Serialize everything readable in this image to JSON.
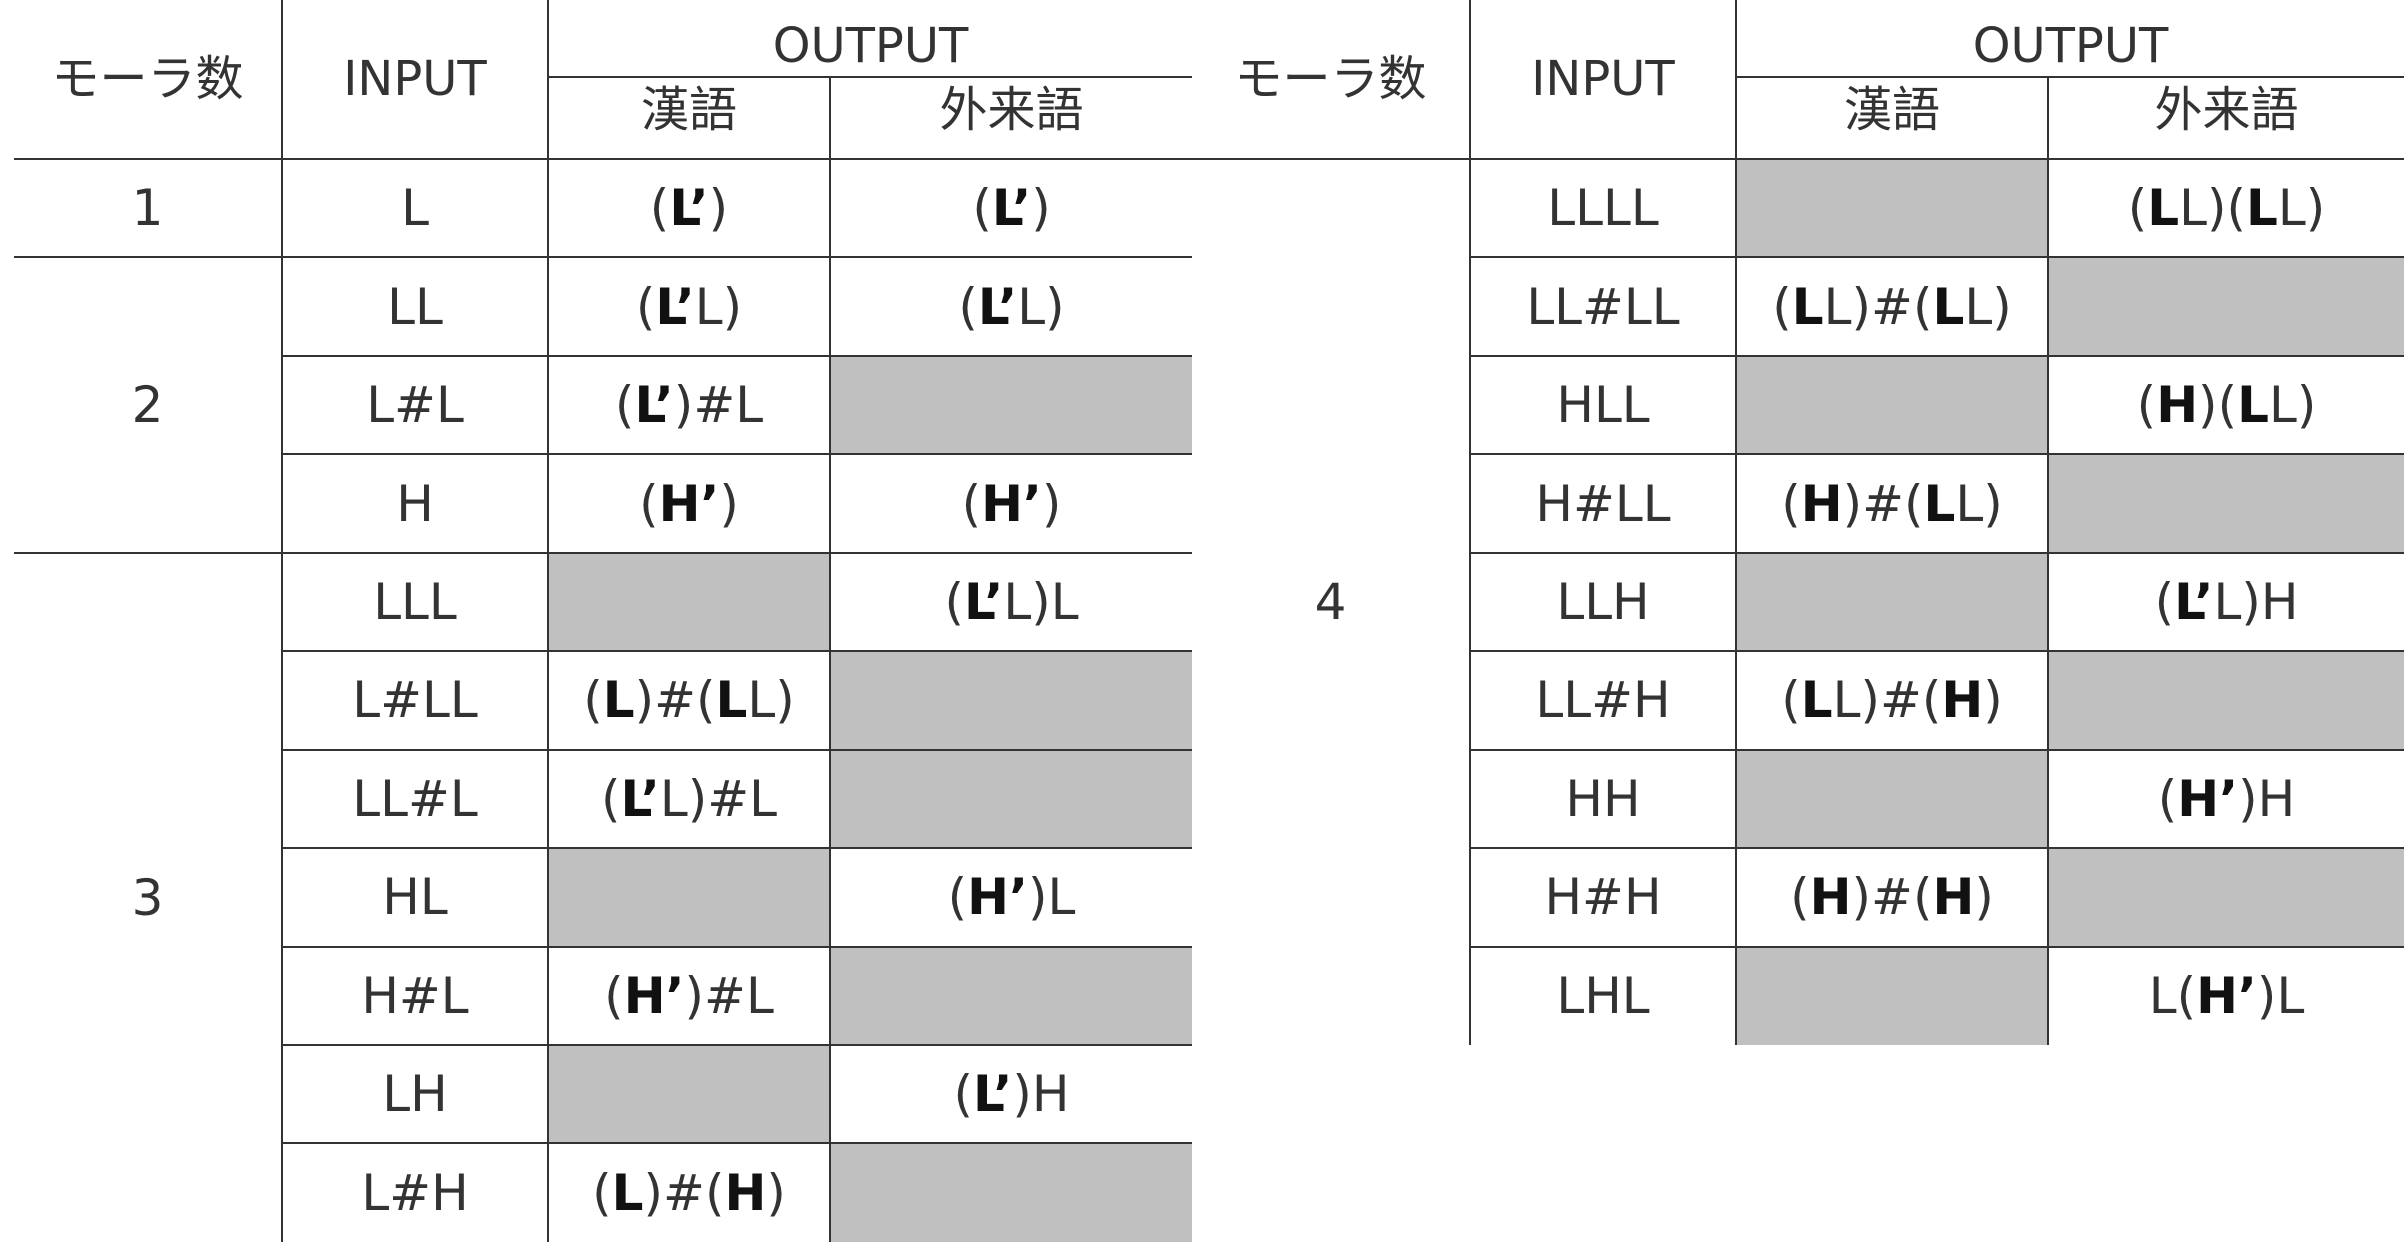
{
  "left_table": {
    "headers": {
      "mora": "モーラ数",
      "input": "INPUT",
      "output": "OUTPUT",
      "kango": "漢語",
      "gairaigo": "外来語"
    },
    "groups": [
      {
        "mora": "1",
        "rows": [
          {
            "input": "L",
            "kango": "(L’)",
            "gairaigo": "(L’)"
          }
        ]
      },
      {
        "mora": "2",
        "rows": [
          {
            "input": "LL",
            "kango": "(L’L)",
            "gairaigo": "(L’L)"
          },
          {
            "input": "L#L",
            "kango": "(L’)#L",
            "gairaigo": ""
          },
          {
            "input": "H",
            "kango": "(H’)",
            "gairaigo": "(H’)"
          }
        ]
      },
      {
        "mora": "3",
        "rows": [
          {
            "input": "LLL",
            "kango": "",
            "gairaigo": "(L’L)L"
          },
          {
            "input": "L#LL",
            "kango": "(L)#(LL)",
            "gairaigo": ""
          },
          {
            "input": "LL#L",
            "kango": "(L’L)#L",
            "gairaigo": ""
          },
          {
            "input": "HL",
            "kango": "",
            "gairaigo": "(H’)L"
          },
          {
            "input": "H#L",
            "kango": "(H’)#L",
            "gairaigo": ""
          },
          {
            "input": "LH",
            "kango": "",
            "gairaigo": "(L’)H"
          },
          {
            "input": "L#H",
            "kango": "(L)#(H)",
            "gairaigo": ""
          }
        ]
      }
    ]
  },
  "right_table": {
    "headers": {
      "mora": "モーラ数",
      "input": "INPUT",
      "output": "OUTPUT",
      "kango": "漢語",
      "gairaigo": "外来語"
    },
    "groups": [
      {
        "mora": "4",
        "rows": [
          {
            "input": "LLLL",
            "kango": "",
            "gairaigo": "(LL)(LL)"
          },
          {
            "input": "LL#LL",
            "kango": "(LL)#(LL)",
            "gairaigo": ""
          },
          {
            "input": "HLL",
            "kango": "",
            "gairaigo": "(H)(LL)"
          },
          {
            "input": "H#LL",
            "kango": "(H)#(LL)",
            "gairaigo": ""
          },
          {
            "input": "LLH",
            "kango": "",
            "gairaigo": "(L’L)H"
          },
          {
            "input": "LL#H",
            "kango": "(LL)#(H)",
            "gairaigo": ""
          },
          {
            "input": "HH",
            "kango": "",
            "gairaigo": "(H’)H"
          },
          {
            "input": "H#H",
            "kango": "(H)#(H)",
            "gairaigo": ""
          },
          {
            "input": "LHL",
            "kango": "",
            "gairaigo": "L(H’)L"
          }
        ]
      }
    ]
  }
}
